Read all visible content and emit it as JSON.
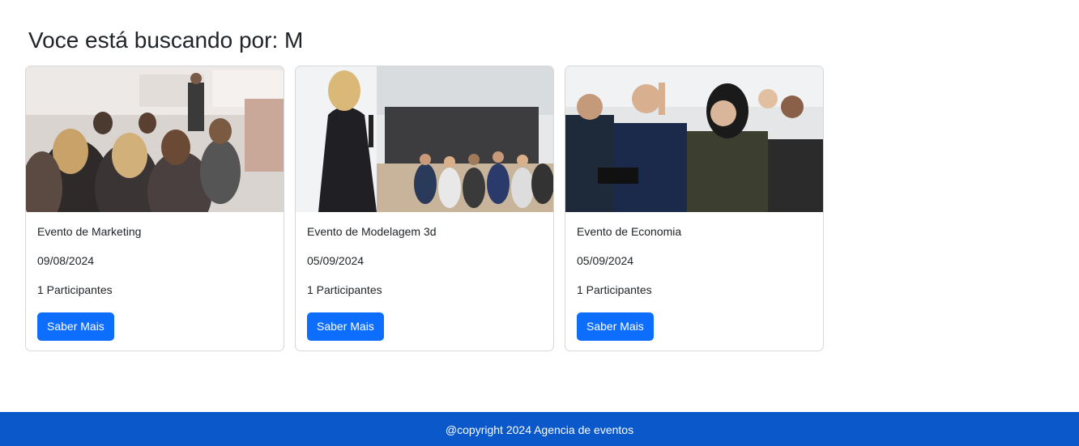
{
  "page": {
    "title": "Voce está buscando por: M"
  },
  "events": [
    {
      "name": "Evento de Marketing",
      "date": "09/08/2024",
      "participants": "1 Participantes",
      "button_label": "Saber Mais",
      "image": "conference-audience-photo"
    },
    {
      "name": "Evento de Modelagem 3d",
      "date": "05/09/2024",
      "participants": "1 Participantes",
      "button_label": "Saber Mais",
      "image": "speaker-presentation-photo"
    },
    {
      "name": "Evento de Economia",
      "date": "05/09/2024",
      "participants": "1 Participantes",
      "button_label": "Saber Mais",
      "image": "audience-raising-hand-photo"
    }
  ],
  "footer": {
    "text": "@copyright 2024 Agencia de eventos"
  },
  "colors": {
    "primary_button": "#0d6efd",
    "footer_bg": "#0a58ca"
  }
}
